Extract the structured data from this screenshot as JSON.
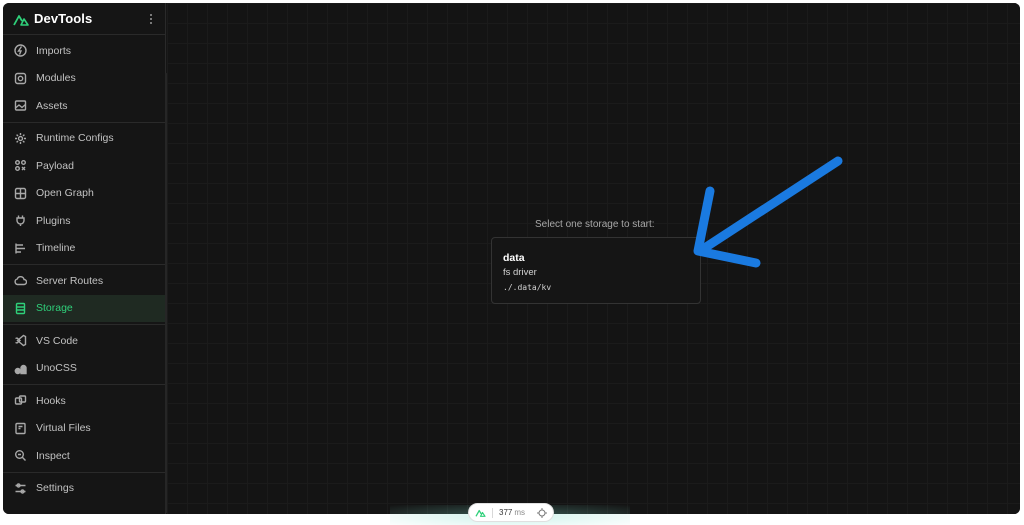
{
  "app": {
    "title": "DevTools"
  },
  "sidebar": {
    "groups": [
      [
        {
          "label": "Imports",
          "icon": "lightning-icon"
        },
        {
          "label": "Modules",
          "icon": "modules-icon"
        },
        {
          "label": "Assets",
          "icon": "image-icon"
        }
      ],
      [
        {
          "label": "Runtime Configs",
          "icon": "gear-icon"
        },
        {
          "label": "Payload",
          "icon": "payload-icon"
        },
        {
          "label": "Open Graph",
          "icon": "open-graph-icon"
        },
        {
          "label": "Plugins",
          "icon": "plug-icon"
        },
        {
          "label": "Timeline",
          "icon": "timeline-icon"
        }
      ],
      [
        {
          "label": "Server Routes",
          "icon": "cloud-icon"
        },
        {
          "label": "Storage",
          "icon": "database-icon",
          "active": true
        }
      ],
      [
        {
          "label": "VS Code",
          "icon": "vscode-icon"
        },
        {
          "label": "UnoCSS",
          "icon": "unocss-icon"
        }
      ],
      [
        {
          "label": "Hooks",
          "icon": "hooks-icon"
        },
        {
          "label": "Virtual Files",
          "icon": "file-icon"
        },
        {
          "label": "Inspect",
          "icon": "inspect-icon"
        }
      ],
      [
        {
          "label": "Settings",
          "icon": "sliders-icon"
        }
      ]
    ]
  },
  "main": {
    "prompt": "Select one storage to start:",
    "storages": [
      {
        "name": "data",
        "driver": "fs driver",
        "path": "./.data/kv"
      }
    ]
  },
  "footer": {
    "time_value": "377",
    "time_unit": "ms"
  },
  "colors": {
    "accent": "#2fd07a",
    "arrow": "#1a7ae0",
    "background": "#151515"
  }
}
